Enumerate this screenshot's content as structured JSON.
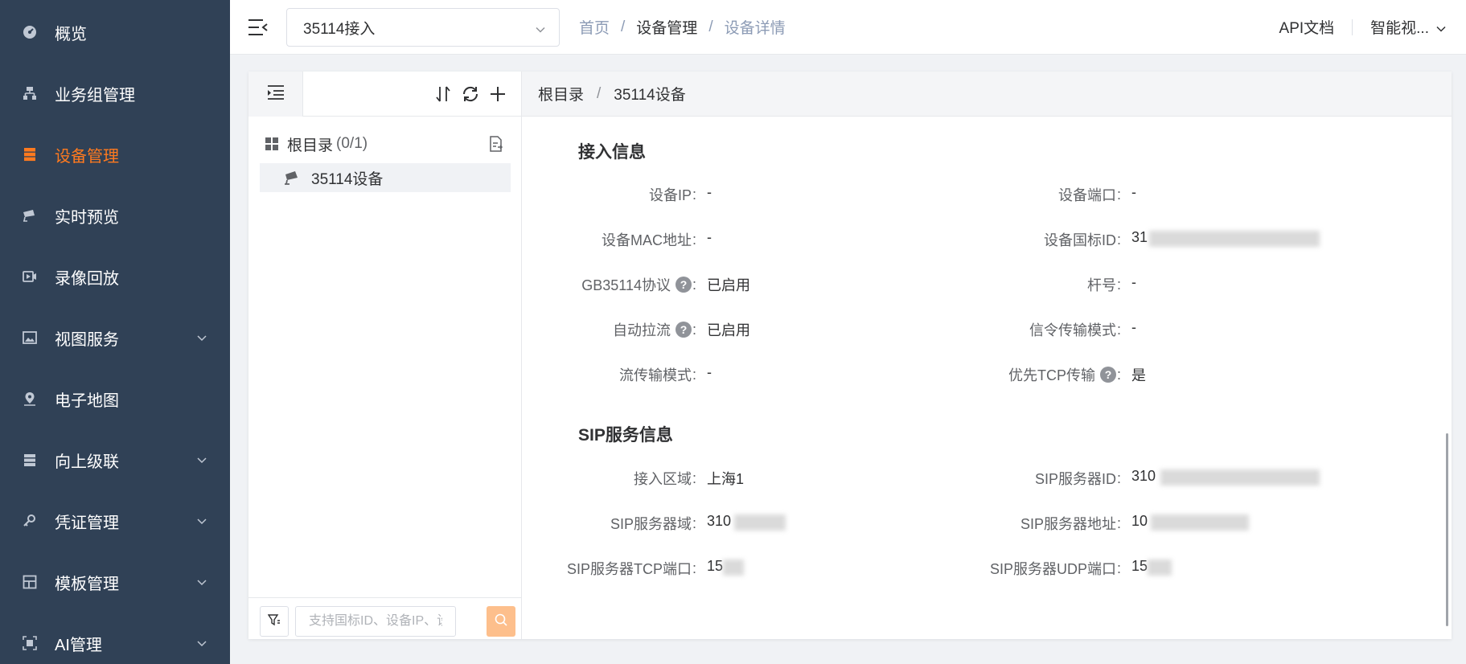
{
  "sidebar": {
    "items": [
      {
        "label": "概览",
        "icon": "dashboard-icon",
        "active": false,
        "has_children": false
      },
      {
        "label": "业务组管理",
        "icon": "org-tree-icon",
        "active": false,
        "has_children": false
      },
      {
        "label": "设备管理",
        "icon": "server-icon",
        "active": true,
        "has_children": false
      },
      {
        "label": "实时预览",
        "icon": "camera-icon",
        "active": false,
        "has_children": false
      },
      {
        "label": "录像回放",
        "icon": "video-playback-icon",
        "active": false,
        "has_children": false
      },
      {
        "label": "视图服务",
        "icon": "image-icon",
        "active": false,
        "has_children": true
      },
      {
        "label": "电子地图",
        "icon": "map-pin-icon",
        "active": false,
        "has_children": false
      },
      {
        "label": "向上级联",
        "icon": "cascade-icon",
        "active": false,
        "has_children": true
      },
      {
        "label": "凭证管理",
        "icon": "key-icon",
        "active": false,
        "has_children": true
      },
      {
        "label": "模板管理",
        "icon": "template-grid-icon",
        "active": false,
        "has_children": true
      },
      {
        "label": "AI管理",
        "icon": "ai-icon",
        "active": false,
        "has_children": true
      }
    ]
  },
  "header": {
    "platform_select": "35114接入",
    "breadcrumb": [
      "首页",
      "设备管理",
      "设备详情"
    ],
    "breadcrumb_sep": "/",
    "api_doc": "API文档",
    "user": "智能视..."
  },
  "tree": {
    "root_label": "根目录",
    "root_count": "(0/1)",
    "nodes": [
      {
        "label": "35114设备"
      }
    ],
    "search_placeholder": "支持国标ID、设备IP、设备名称"
  },
  "detail": {
    "breadcrumb": [
      "根目录",
      "35114设备"
    ],
    "breadcrumb_sep": "/",
    "access_section": {
      "title": "接入信息",
      "fields": {
        "device_ip": {
          "label": "设备IP",
          "value": "-"
        },
        "device_port": {
          "label": "设备端口",
          "value": "-"
        },
        "device_mac": {
          "label": "设备MAC地址",
          "value": "-"
        },
        "device_gb_id": {
          "label": "设备国标ID",
          "value": "31"
        },
        "gb35114": {
          "label": "GB35114协议",
          "value": "已启用"
        },
        "pole_no": {
          "label": "杆号",
          "value": "-"
        },
        "auto_pull": {
          "label": "自动拉流",
          "value": "已启用"
        },
        "signal_mode": {
          "label": "信令传输模式",
          "value": "-"
        },
        "stream_mode": {
          "label": "流传输模式",
          "value": "-"
        },
        "tcp_priority": {
          "label": "优先TCP传输",
          "value": "是"
        }
      }
    },
    "sip_section": {
      "title": "SIP服务信息",
      "fields": {
        "access_region": {
          "label": "接入区域",
          "value": "上海1"
        },
        "sip_server_id": {
          "label": "SIP服务器ID",
          "value": "310"
        },
        "sip_server_domain": {
          "label": "SIP服务器域",
          "value": "310"
        },
        "sip_server_addr": {
          "label": "SIP服务器地址",
          "value": "10"
        },
        "sip_tcp_port": {
          "label": "SIP服务器TCP端口",
          "value": "15"
        },
        "sip_udp_port": {
          "label": "SIP服务器UDP端口",
          "value": "15"
        }
      }
    },
    "colon": ":",
    "help_glyph": "?"
  },
  "colors": {
    "sidebar_bg": "#304156",
    "accent": "#ff7a1f",
    "search_btn": "#fdbf8c"
  }
}
